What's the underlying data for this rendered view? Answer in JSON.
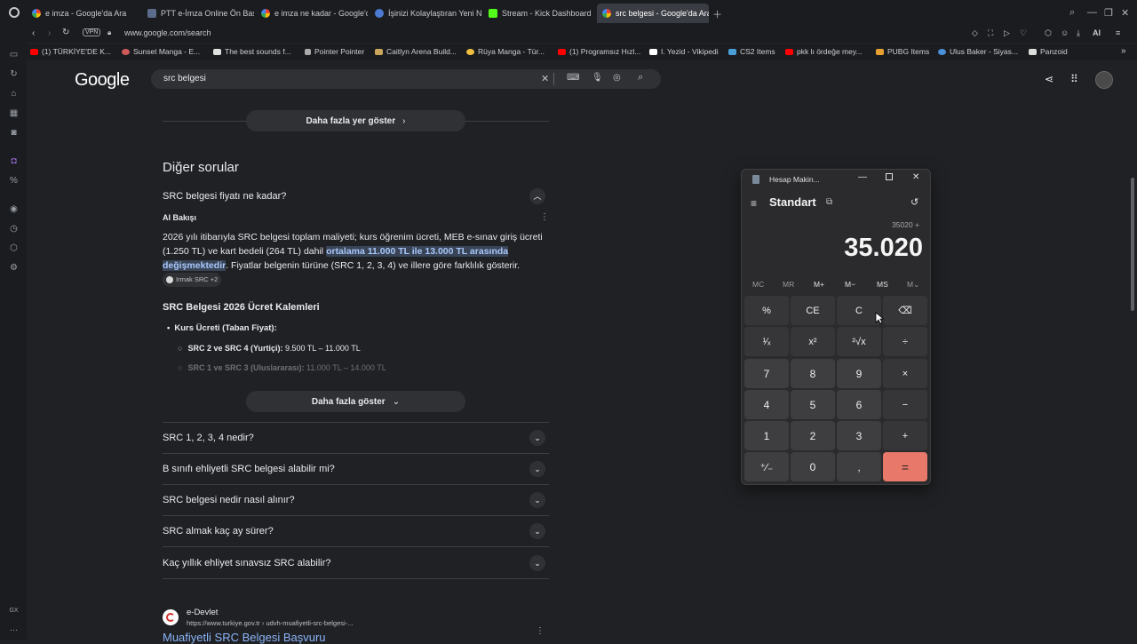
{
  "browser": {
    "tabs": [
      {
        "label": "e imza - Google'da Ara",
        "active": false
      },
      {
        "label": "PTT e-İmza Online Ön Baş",
        "active": false
      },
      {
        "label": "e imza ne kadar - Google'd",
        "active": false
      },
      {
        "label": "İşinizi Kolaylaştıran Yeni Ne",
        "active": false
      },
      {
        "label": "Stream - Kick Dashboard",
        "active": false
      },
      {
        "label": "src belgesi - Google'da Ara",
        "active": true
      }
    ],
    "address": "www.google.com/search",
    "vpn_label": "VPN",
    "ai_label": "AI",
    "bookmarks": [
      "(1) TÜRKİYE'DE K...",
      "Sunset Manga - E...",
      "The best sounds f...",
      "Pointer Pointer",
      "Caitlyn Arena Build...",
      "Rüya Manga - Tür...",
      "(1) Programsız Hızl...",
      "I. Yezid - Vikipedi",
      "CS2 Items",
      "pkk lı ördeğe mey...",
      "PUBG Items",
      "Ulus Baker - Siyas...",
      "Panzoid"
    ],
    "sidebar_bottom_label": "GX"
  },
  "google": {
    "logo": "Google",
    "query": "src belgesi",
    "more_places": "Daha fazla yer göster",
    "other_questions_title": "Diğer sorular",
    "q1": "SRC belgesi fiyatı ne kadar?",
    "ai_label": "AI Bakışı",
    "ai_text_before": "2026 yılı itibarıyla SRC belgesi toplam maliyeti; kurs öğrenim ücreti, MEB e-sınav giriş ücreti (1.250 TL) ve kart bedeli (264 TL) dahil ",
    "ai_text_highlight": "ortalama 11.000 TL ile 13.000 TL arasında değişmektedir",
    "ai_text_after": ". Fiyatlar belgenin türüne (SRC 1, 2, 3, 4) ve illere göre farklılık gösterir.",
    "ai_source": "Irmak SRC +2",
    "fees_title": "SRC Belgesi 2026 Ücret Kalemleri",
    "fee_heading": "Kurs Ücreti (Taban Fiyat):",
    "fee_items": [
      {
        "name": "SRC 2 ve SRC 4 (Yurtiçi):",
        "value": " 9.500 TL – 11.000 TL"
      },
      {
        "name": "SRC 1 ve SRC 3 (Uluslararası):",
        "value": " 11.000 TL – 14.000 TL"
      }
    ],
    "show_more": "Daha fazla göster",
    "questions": [
      "SRC 1, 2, 3, 4 nedir?",
      "B sınıfı ehliyetli SRC belgesi alabilir mi?",
      "SRC belgesi nedir nasıl alınır?",
      "SRC almak kaç ay sürer?",
      "Kaç yıllık ehliyet sınavsız SRC alabilir?"
    ],
    "result": {
      "site": "e-Devlet",
      "url": "https://www.turkiye.gov.tr › udvh-muafiyetli-src-belgesi-...",
      "title": "Muafiyetli SRC Belgesi Başvuru"
    }
  },
  "calculator": {
    "window_title": "Hesap Makin...",
    "mode": "Standart",
    "expression": "35020 +",
    "display": "35.020",
    "memory": [
      "MC",
      "MR",
      "M+",
      "M−",
      "MS",
      "M⌄"
    ],
    "keys": [
      [
        "%",
        "CE",
        "C",
        "⌫"
      ],
      [
        "¹⁄ₓ",
        "x²",
        "²√x",
        "÷"
      ],
      [
        "7",
        "8",
        "9",
        "×"
      ],
      [
        "4",
        "5",
        "6",
        "−"
      ],
      [
        "1",
        "2",
        "3",
        "+"
      ],
      [
        "⁺∕₋",
        "0",
        ",",
        "="
      ]
    ],
    "accent_color": "#e8786a"
  }
}
